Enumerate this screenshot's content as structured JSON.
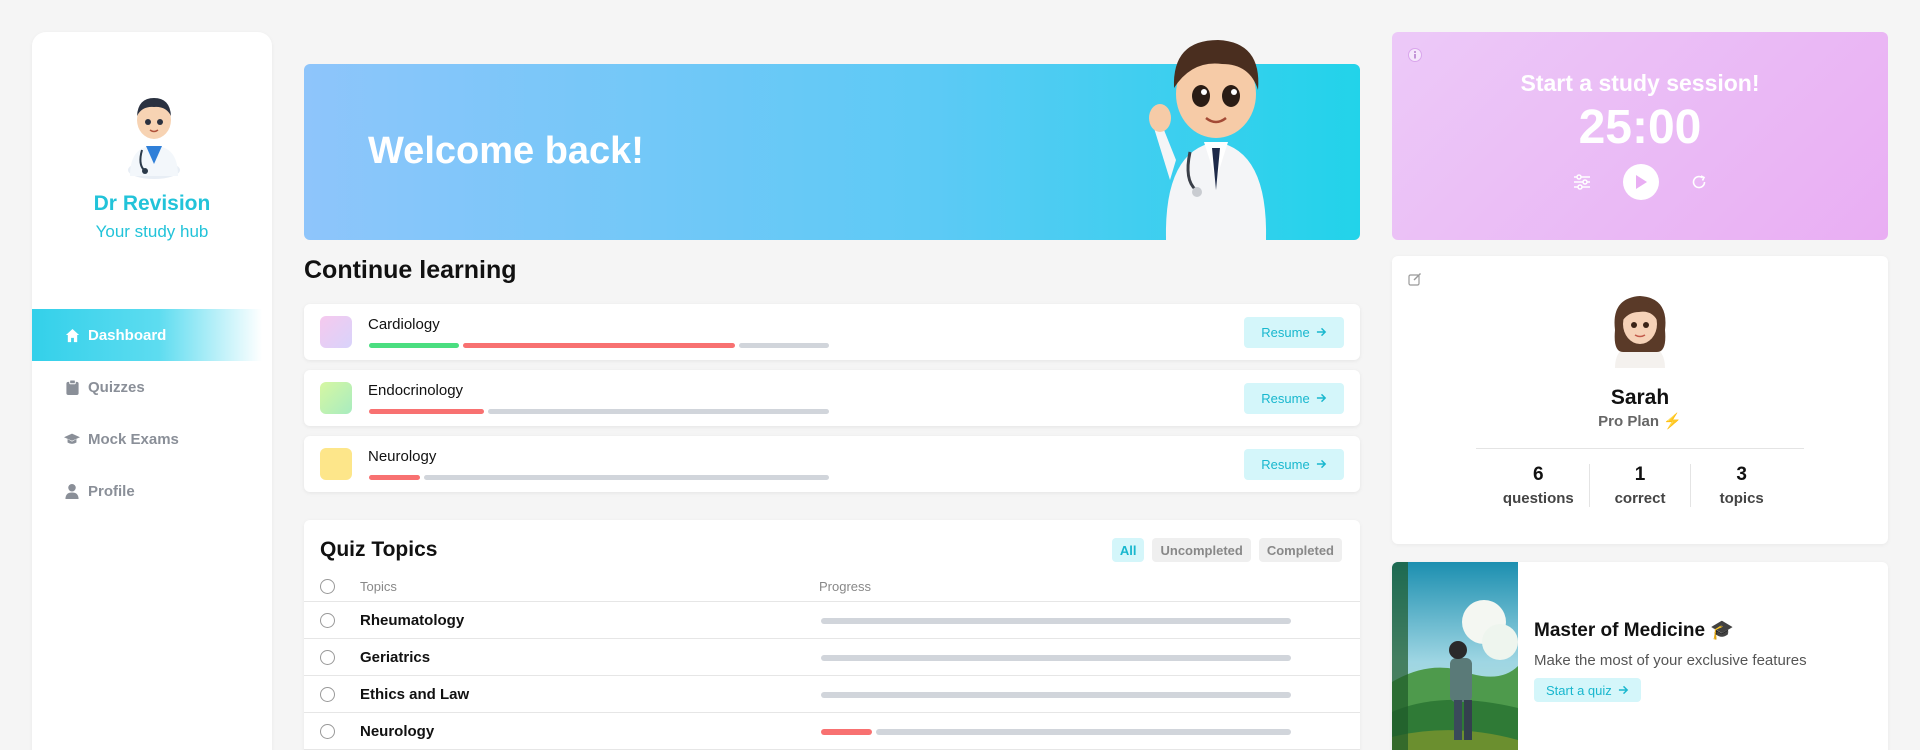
{
  "brand": {
    "name": "Dr Revision",
    "subtitle": "Your study hub"
  },
  "nav": [
    {
      "label": "Dashboard",
      "icon": "home-icon",
      "active": true
    },
    {
      "label": "Quizzes",
      "icon": "clipboard-icon",
      "active": false
    },
    {
      "label": "Mock Exams",
      "icon": "graduation-cap-icon",
      "active": false
    },
    {
      "label": "Profile",
      "icon": "user-icon",
      "active": false
    }
  ],
  "banner": {
    "title": "Welcome back!"
  },
  "continue_learning": {
    "title": "Continue learning",
    "resume_label": "Resume",
    "courses": [
      {
        "name": "Cardiology",
        "swatch": "linear-gradient(135deg,#f6c9ee,#d8d3fb)"
      },
      {
        "name": "Endocrinology",
        "swatch": "linear-gradient(135deg,#d6f7a2,#a8ecc0)"
      },
      {
        "name": "Neurology",
        "swatch": "#fde68a"
      }
    ]
  },
  "quiz_topics": {
    "title": "Quiz Topics",
    "filters": [
      "All",
      "Uncompleted",
      "Completed"
    ],
    "active_filter": "All",
    "col_topics": "Topics",
    "col_progress": "Progress",
    "rows": [
      {
        "name": "Rheumatology"
      },
      {
        "name": "Geriatrics"
      },
      {
        "name": "Ethics and Law"
      },
      {
        "name": "Neurology"
      }
    ]
  },
  "study_session": {
    "title": "Start a study session!",
    "time": "25:00"
  },
  "profile": {
    "name": "Sarah",
    "plan": "Pro Plan",
    "plan_icon": "⚡",
    "stats": [
      {
        "value": "6",
        "label": "questions"
      },
      {
        "value": "1",
        "label": "correct"
      },
      {
        "value": "3",
        "label": "topics"
      }
    ]
  },
  "promo": {
    "title": "Master of Medicine",
    "title_icon": "🎓",
    "description": "Make the most of your exclusive features",
    "button_label": "Start a quiz"
  },
  "colors": {
    "accent": "#22c3d9",
    "green": "#4ade80",
    "red": "#f87171",
    "gray": "#d1d5db"
  }
}
